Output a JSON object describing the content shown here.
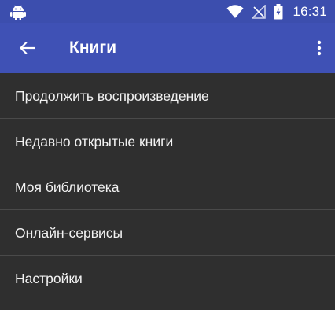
{
  "status_bar": {
    "time": "16:31",
    "icons": [
      "android-icon",
      "wifi-icon",
      "signal-off-icon",
      "battery-charging-icon"
    ]
  },
  "app_bar": {
    "title": "Книги",
    "back_icon": "back-arrow-icon",
    "overflow_icon": "more-vert-icon"
  },
  "menu": {
    "items": [
      {
        "label": "Продолжить воспроизведение"
      },
      {
        "label": "Недавно открытые книги"
      },
      {
        "label": "Моя библиотека"
      },
      {
        "label": "Онлайн-сервисы"
      },
      {
        "label": "Настройки"
      }
    ]
  },
  "colors": {
    "app_bar": "#3f51b5",
    "status_bar": "#3c4eae",
    "background": "#2f2f2f",
    "divider": "#4a4a4a",
    "text": "#f2f2f2"
  }
}
